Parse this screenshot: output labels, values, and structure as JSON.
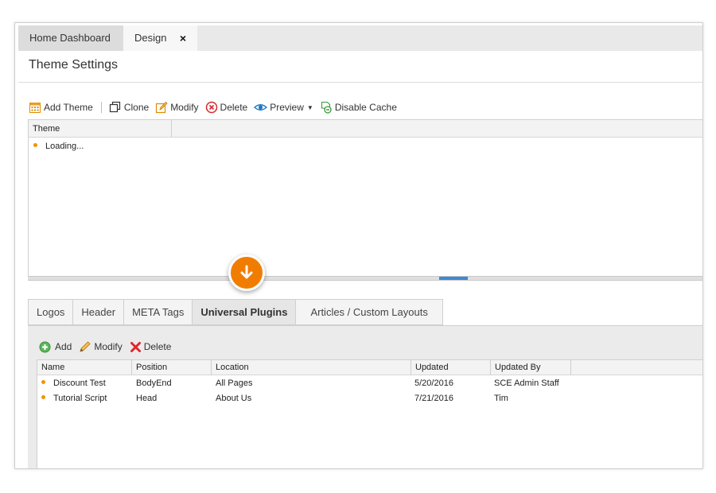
{
  "tabs": {
    "home": "Home Dashboard",
    "design": "Design",
    "close": "×"
  },
  "page": {
    "title": "Theme Settings"
  },
  "toolbar": {
    "add_theme": "Add Theme",
    "clone": "Clone",
    "modify": "Modify",
    "delete": "Delete",
    "preview": "Preview",
    "disable_cache": "Disable Cache"
  },
  "theme_grid": {
    "column": "Theme",
    "loading": "Loading..."
  },
  "lower_tabs": [
    "Logos",
    "Header",
    "META Tags",
    "Universal Plugins",
    "Articles / Custom Layouts"
  ],
  "lower_toolbar": {
    "add": "Add",
    "modify": "Modify",
    "delete": "Delete"
  },
  "plugins_grid": {
    "columns": [
      "Name",
      "Position",
      "Location",
      "Updated",
      "Updated By"
    ],
    "rows": [
      [
        "Discount Test",
        "BodyEnd",
        "All Pages",
        "5/20/2016",
        "SCE Admin Staff"
      ],
      [
        "Tutorial Script",
        "Head",
        "About Us",
        "7/21/2016",
        "Tim"
      ]
    ]
  },
  "colors": {
    "accent_orange": "#f07d00",
    "bullet_orange": "#f29400",
    "splitter_blue": "#3b8ad8"
  }
}
